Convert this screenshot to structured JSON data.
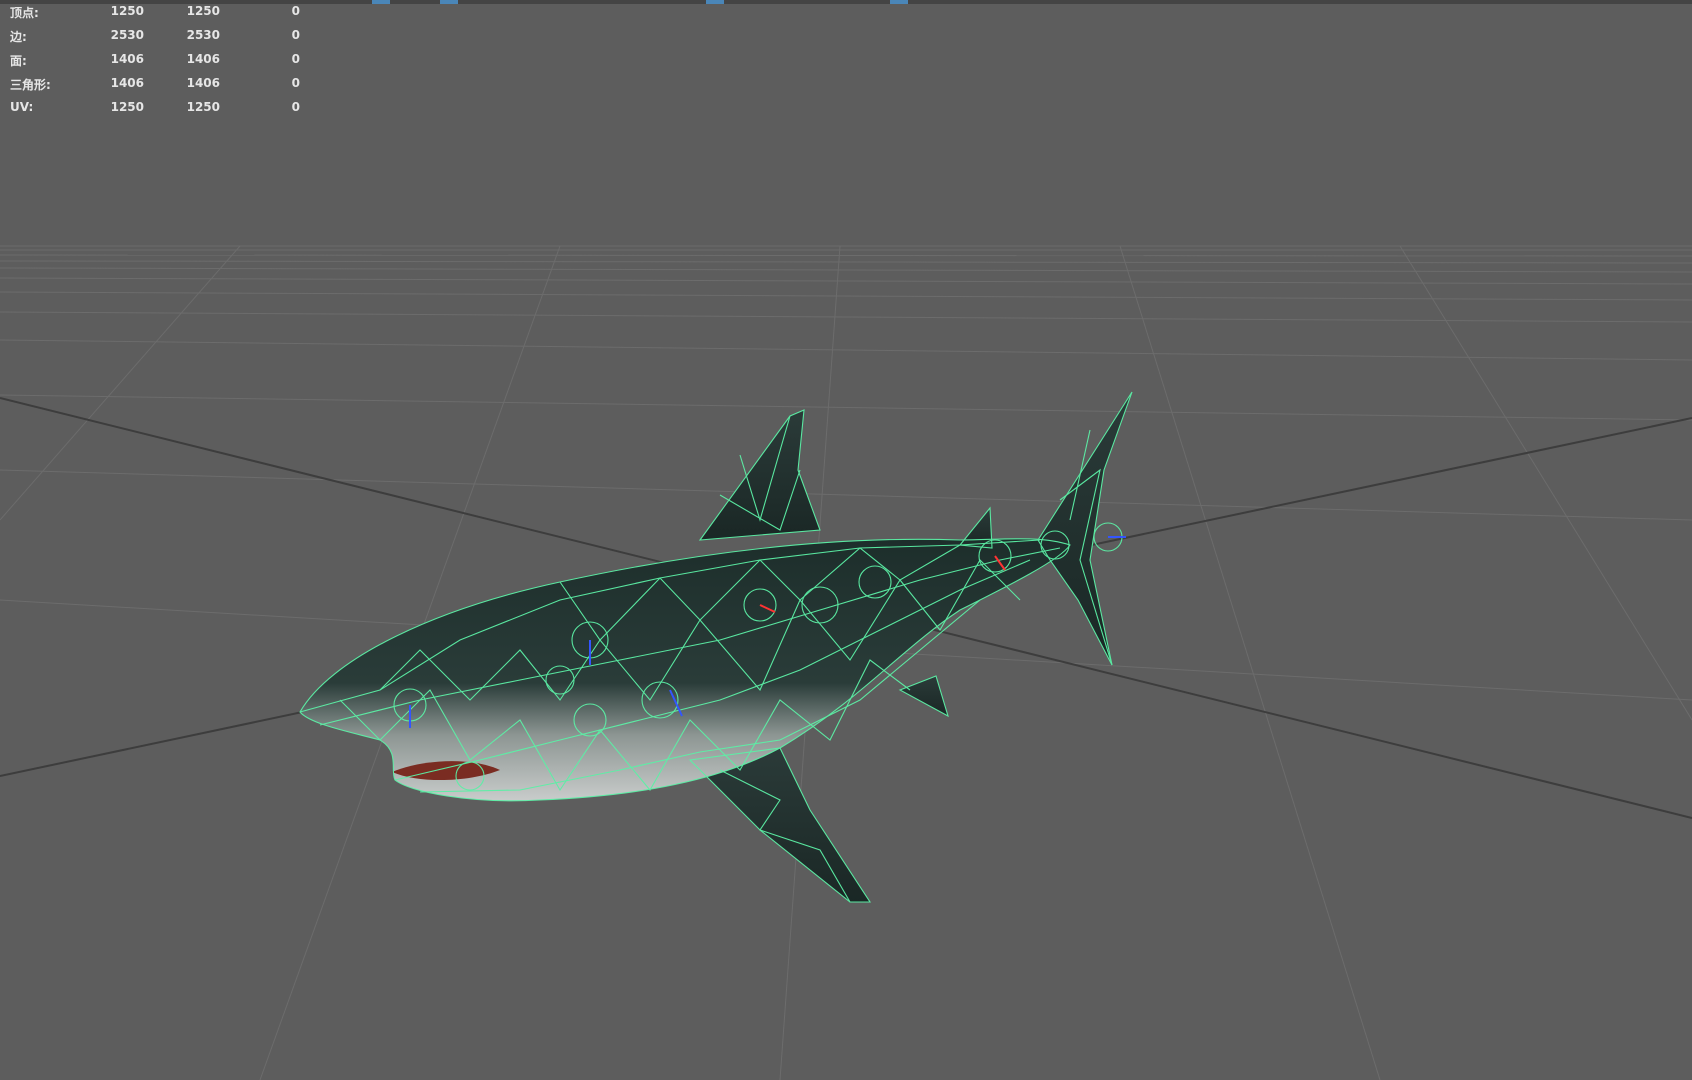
{
  "viewport": {
    "background": "#5d5d5d",
    "wireframe_color": "#5cf0a6",
    "model": "shark",
    "display_mode": "wireframe-on-shaded"
  },
  "hud": {
    "rows": [
      {
        "label": "顶点:",
        "v1": "1250",
        "v2": "1250",
        "v3": "0"
      },
      {
        "label": "边:",
        "v1": "2530",
        "v2": "2530",
        "v3": "0"
      },
      {
        "label": "面:",
        "v1": "1406",
        "v2": "1406",
        "v3": "0"
      },
      {
        "label": "三角形:",
        "v1": "1406",
        "v2": "1406",
        "v3": "0"
      },
      {
        "label": "UV:",
        "v1": "1250",
        "v2": "1250",
        "v3": "0"
      }
    ]
  },
  "icons": {
    "top_strip": "toolbar-strip",
    "joints": "joint-icon"
  }
}
